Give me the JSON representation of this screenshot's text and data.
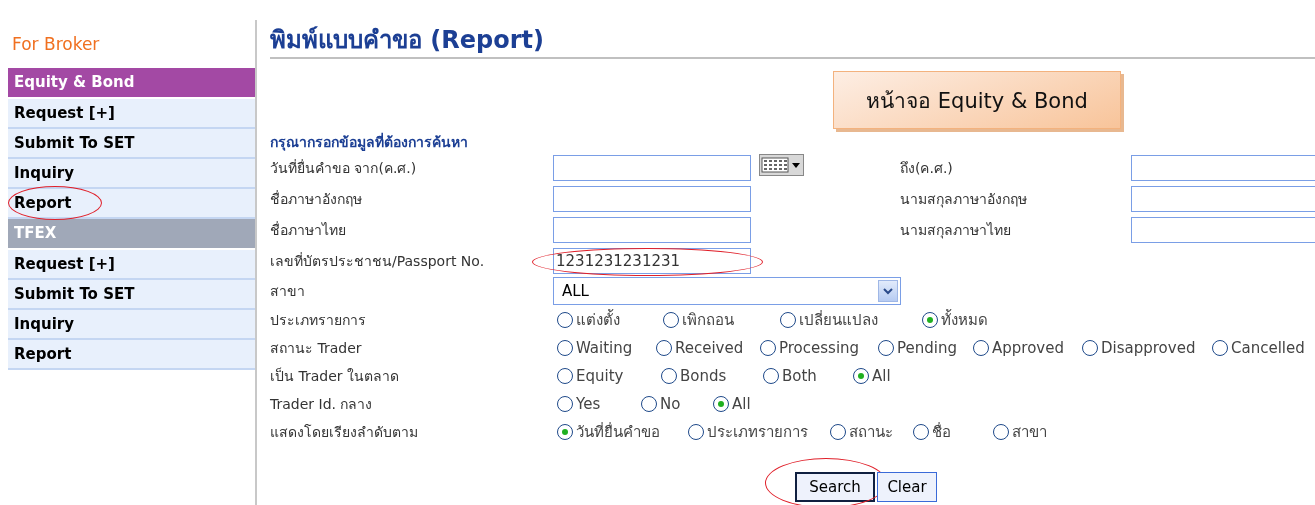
{
  "sidebar": {
    "title": "For Broker",
    "sections": [
      {
        "label": "Equity & Bond",
        "color": "#a349a4",
        "items": [
          {
            "label": "Request [+]",
            "circled": false
          },
          {
            "label": "Submit To SET",
            "circled": false
          },
          {
            "label": "Inquiry",
            "circled": false
          },
          {
            "label": "Report",
            "circled": true
          }
        ]
      },
      {
        "label": "TFEX",
        "color": "#a0a8b8",
        "items": [
          {
            "label": "Request [+]",
            "circled": false
          },
          {
            "label": "Submit To SET",
            "circled": false
          },
          {
            "label": "Inquiry",
            "circled": false
          },
          {
            "label": "Report",
            "circled": false
          }
        ]
      }
    ]
  },
  "page": {
    "title": "พิมพ์แบบคำขอ (Report)",
    "callout": "หน้าจอ Equity & Bond",
    "form_heading": "กรุณากรอกข้อมูลที่ต้องการค้นหา",
    "rows": [
      {
        "kind": "text",
        "label": "วันที่ยื่นคำขอ จาก(ค.ศ.)",
        "calendar": true,
        "circled": false,
        "right": {
          "label": "ถึง(ค.ศ.)"
        }
      },
      {
        "kind": "text",
        "label": "ชื่อภาษาอังกฤษ",
        "calendar": false,
        "circled": false,
        "right": {
          "label": "นามสกุลภาษาอังกฤษ"
        }
      },
      {
        "kind": "text",
        "label": "ชื่อภาษาไทย",
        "calendar": false,
        "circled": false,
        "right": {
          "label": "นามสกุลภาษาไทย"
        }
      },
      {
        "kind": "text",
        "label": "เลขที่บัตรประชาชน/Passport No.",
        "value": "1231231231231",
        "calendar": false,
        "circled": true
      },
      {
        "kind": "select",
        "label": "สาขา",
        "value": "ALL"
      },
      {
        "kind": "radio",
        "label": "ประเภทรายการ",
        "options": [
          {
            "label": "แต่งตั้ง",
            "selected": false
          },
          {
            "label": "เพิกถอน",
            "selected": false
          },
          {
            "label": "เปลี่ยนแปลง",
            "selected": false
          },
          {
            "label": "ทั้งหมด",
            "selected": true
          }
        ]
      },
      {
        "kind": "radio",
        "label": "สถานะ Trader",
        "options": [
          {
            "label": "Waiting",
            "selected": false
          },
          {
            "label": "Received",
            "selected": false
          },
          {
            "label": "Processing",
            "selected": false
          },
          {
            "label": "Pending",
            "selected": false
          },
          {
            "label": "Approved",
            "selected": false
          },
          {
            "label": "Disapproved",
            "selected": false
          },
          {
            "label": "Cancelled",
            "selected": false
          }
        ]
      },
      {
        "kind": "radio",
        "label": "เป็น Trader ในตลาด",
        "options": [
          {
            "label": "Equity",
            "selected": false
          },
          {
            "label": "Bonds",
            "selected": false
          },
          {
            "label": "Both",
            "selected": false
          },
          {
            "label": "All",
            "selected": true
          }
        ]
      },
      {
        "kind": "radio",
        "label": "Trader Id. กลาง",
        "options": [
          {
            "label": "Yes",
            "selected": false
          },
          {
            "label": "No",
            "selected": false
          },
          {
            "label": "All",
            "selected": true
          }
        ]
      },
      {
        "kind": "radio",
        "label": "แสดงโดยเรียงลำดับตาม",
        "options": [
          {
            "label": "วันที่ยื่นคำขอ",
            "selected": true
          },
          {
            "label": "ประเภทรายการ",
            "selected": false
          },
          {
            "label": "สถานะ",
            "selected": false
          },
          {
            "label": "ชื่อ",
            "selected": false
          },
          {
            "label": "สาขา",
            "selected": false
          }
        ]
      }
    ],
    "buttons": [
      {
        "label": "Search",
        "focused": true,
        "circled": true
      },
      {
        "label": "Clear",
        "focused": false,
        "circled": false
      }
    ]
  }
}
